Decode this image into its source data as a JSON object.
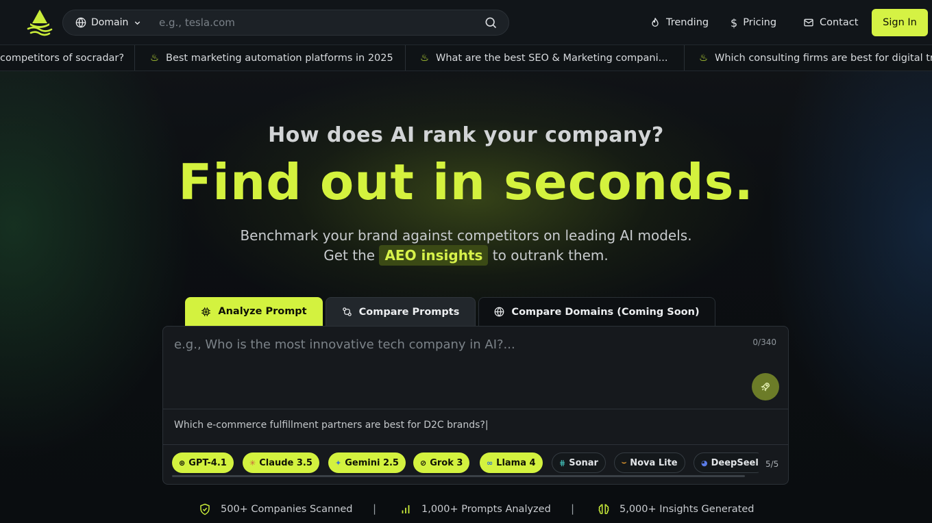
{
  "header": {
    "domain_select_label": "Domain",
    "search_placeholder": "e.g., tesla.com",
    "nav": {
      "trending": "Trending",
      "pricing": "Pricing",
      "contact": "Contact"
    },
    "signin_label": "Sign In"
  },
  "ticker": {
    "items": [
      "competitors of socradar?",
      "Best marketing automation platforms in 2025",
      "What are the best SEO & Marketing compani...",
      "Which consulting firms are best for digital tr"
    ]
  },
  "hero": {
    "question": "How does AI rank your company?",
    "headline": "Find out in seconds.",
    "sub_line1": "Benchmark your brand against competitors on leading AI models.",
    "sub_line2_pre": "Get the",
    "sub_line2_highlight": "AEO insights",
    "sub_line2_post": "to outrank them."
  },
  "tabs": {
    "analyze": "Analyze Prompt",
    "compare_prompts": "Compare Prompts",
    "compare_domains": "Compare Domains (Coming Soon)"
  },
  "panel": {
    "prompt_placeholder": "e.g., Who is the most innovative tech company in AI?...",
    "char_count": "0/340",
    "typing_example": "Which e-commerce fulfillment partners are best for D2C brands?|",
    "model_count": "5/5",
    "models": [
      {
        "name": "GPT-4.1",
        "selected": true,
        "icon": "⊛"
      },
      {
        "name": "Claude 3.5",
        "selected": true,
        "icon": "✳"
      },
      {
        "name": "Gemini 2.5",
        "selected": true,
        "icon": "✦"
      },
      {
        "name": "Grok 3",
        "selected": true,
        "icon": "⊘"
      },
      {
        "name": "Llama 4",
        "selected": true,
        "icon": "∞"
      },
      {
        "name": "Sonar",
        "selected": false,
        "icon": "⋕"
      },
      {
        "name": "Nova Lite",
        "selected": false,
        "icon": "⌣"
      },
      {
        "name": "DeepSeel",
        "selected": false,
        "icon": "◕"
      }
    ]
  },
  "stats": {
    "companies": "500+ Companies Scanned",
    "prompts": "1,000+ Prompts Analyzed",
    "insights": "5,000+ Insights Generated",
    "separator": "|"
  },
  "colors": {
    "accent": "#d3f23f",
    "background": "#0a0d10",
    "panel": "#16191d"
  }
}
